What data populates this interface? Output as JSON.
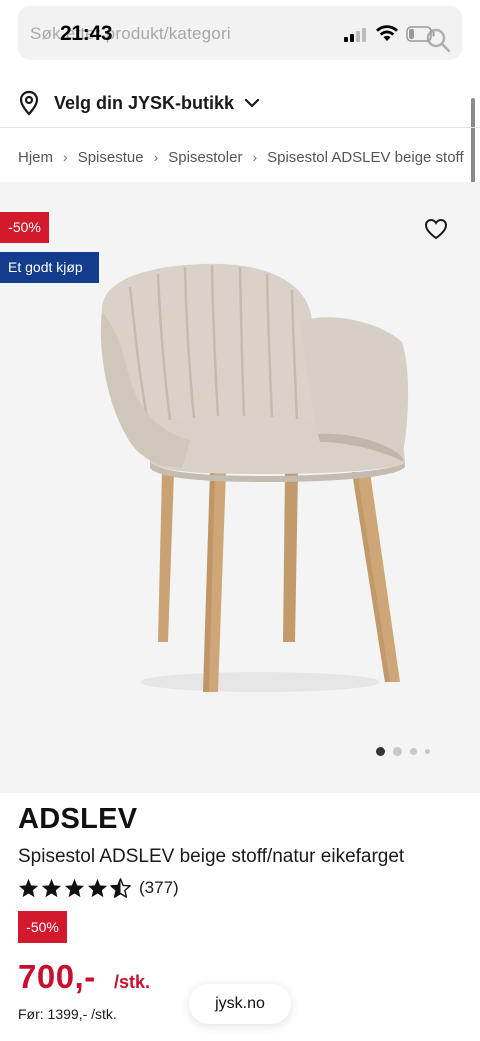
{
  "status_bar": {
    "time": "21:43"
  },
  "search": {
    "placeholder": "Søk etter produkt/kategori"
  },
  "store": {
    "label": "Velg din JYSK-butikk"
  },
  "breadcrumb": [
    "Hjem",
    "Spisestue",
    "Spisestoler",
    "Spisestol ADSLEV beige stoff"
  ],
  "gallery": {
    "discount_badge": "-50%",
    "deal_badge": "Et godt kjøp",
    "dot_count": 4,
    "active_dot": 0
  },
  "product": {
    "name": "ADSLEV",
    "description": "Spisestol ADSLEV beige stoff/natur eikefarget",
    "rating": 4.5,
    "rating_count": "(377)",
    "discount_badge": "-50%",
    "price": "700,-",
    "price_unit": "/stk.",
    "before_price": "Før: 1399,- /stk."
  },
  "browser": {
    "domain": "jysk.no"
  },
  "colors": {
    "sale_red": "#d3192c",
    "price_red": "#c8102e",
    "deal_blue": "#143c8c"
  }
}
